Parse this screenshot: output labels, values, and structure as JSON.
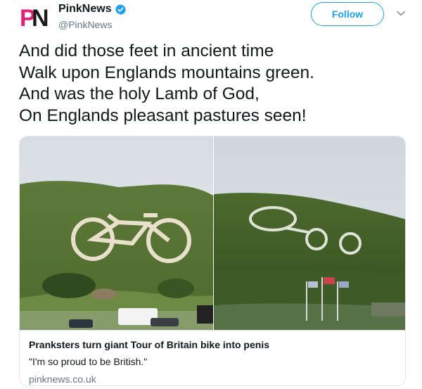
{
  "author": {
    "logo_text": "PN",
    "name": "PinkNews",
    "handle": "@PinkNews",
    "verified": true,
    "avatar_color": "#e91e7a"
  },
  "actions": {
    "follow_label": "Follow",
    "more_icon": "chevron-down-icon"
  },
  "tweet": {
    "lines": [
      "And did those feet in ancient time",
      "Walk upon Englands mountains green.",
      "And was the holy Lamb of God,",
      "On Englands pleasant pastures seen!"
    ]
  },
  "card": {
    "title": "Pranksters turn giant Tour of Britain bike into penis",
    "description": "\"I'm so proud to be British.\"",
    "domain": "pinknews.co.uk"
  },
  "colors": {
    "accent": "#1da1f2",
    "text": "#14171a",
    "secondary": "#657786",
    "border": "#e1e8ed",
    "brand_pink": "#e91e7a"
  }
}
